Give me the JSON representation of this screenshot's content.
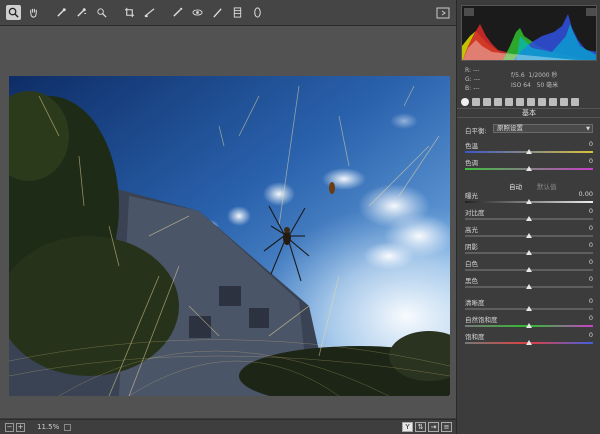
{
  "toolbar": {
    "tools": [
      "zoom-tool",
      "hand-tool",
      "white-balance-tool",
      "color-sampler-tool",
      "targeted-adjustment-tool",
      "crop-tool",
      "straighten-tool",
      "spot-removal-tool",
      "red-eye-tool",
      "adjustment-brush-tool",
      "graduated-filter-tool",
      "radial-filter-tool"
    ],
    "right_button": "open-preferences"
  },
  "statusbar": {
    "zoom": "11.5%",
    "view_buttons": [
      "Y"
    ]
  },
  "panel": {
    "readout": {
      "r_label": "R:",
      "r_value": "---",
      "g_label": "G:",
      "g_value": "---",
      "b_label": "B:",
      "b_value": "---",
      "aperture": "f/5.6",
      "shutter": "1/2000 秒",
      "iso": "ISO 64",
      "focal": "50 毫米"
    },
    "section_title": "基本",
    "white_balance": {
      "label": "白平衡:",
      "value": "原照设置"
    },
    "temperature": {
      "label": "色温",
      "value": "0"
    },
    "tint": {
      "label": "色调",
      "value": "0"
    },
    "auto_label": "自动",
    "default_label": "默认值",
    "sliders": [
      {
        "label": "曝光",
        "value": "0.00",
        "pos": 0.5
      },
      {
        "label": "对比度",
        "value": "0",
        "pos": 0.5
      },
      {
        "label": "高光",
        "value": "0",
        "pos": 0.5
      },
      {
        "label": "阴影",
        "value": "0",
        "pos": 0.5
      },
      {
        "label": "白色",
        "value": "0",
        "pos": 0.5
      },
      {
        "label": "黑色",
        "value": "0",
        "pos": 0.5
      }
    ],
    "presence": [
      {
        "label": "清晰度",
        "value": "0",
        "pos": 0.5
      },
      {
        "label": "自然饱和度",
        "value": "0",
        "pos": 0.5
      },
      {
        "label": "饱和度",
        "value": "0",
        "pos": 0.5
      }
    ]
  },
  "colors": {
    "temperature_gradient": [
      "#3b55c9",
      "#d9c23b"
    ],
    "tint_gradient": [
      "#3fbf3f",
      "#c93fc9"
    ]
  }
}
